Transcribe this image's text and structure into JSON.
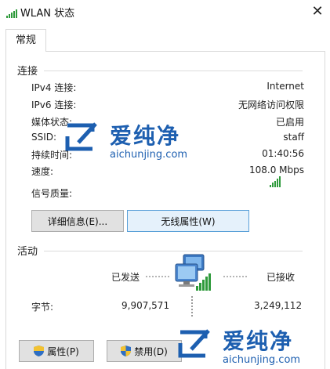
{
  "window": {
    "title": "WLAN 状态",
    "close_glyph": "✕"
  },
  "tabs": [
    {
      "label": "常规"
    }
  ],
  "connection": {
    "group_title": "连接",
    "rows": [
      {
        "label": "IPv4 连接:",
        "value": "Internet"
      },
      {
        "label": "IPv6 连接:",
        "value": "无网络访问权限"
      },
      {
        "label": "媒体状态:",
        "value": "已启用"
      },
      {
        "label": "SSID:",
        "value": "staff"
      },
      {
        "label": "持续时间:",
        "value": "01:40:56"
      },
      {
        "label": "速度:",
        "value": "108.0 Mbps"
      },
      {
        "label": "信号质量:",
        "value": ""
      }
    ],
    "signal_bars_active": 5,
    "signal_bars_total": 5,
    "details_button": "详细信息(E)...",
    "wireless_props_button": "无线属性(W)"
  },
  "activity": {
    "group_title": "活动",
    "sent_label": "已发送",
    "received_label": "已接收",
    "bytes_label": "字节:",
    "bytes_sent": "9,907,571",
    "bytes_received": "3,249,112",
    "icon": "network-computer-icon"
  },
  "footer": {
    "properties_button": "属性(P)",
    "disable_button": "禁用(D)"
  },
  "watermark": {
    "name": "爱纯净",
    "url": "aichunjing.com"
  },
  "colors": {
    "accent": "#5aa0d8",
    "signal": "#2e9a3b",
    "watermark": "#1d5fb0"
  }
}
